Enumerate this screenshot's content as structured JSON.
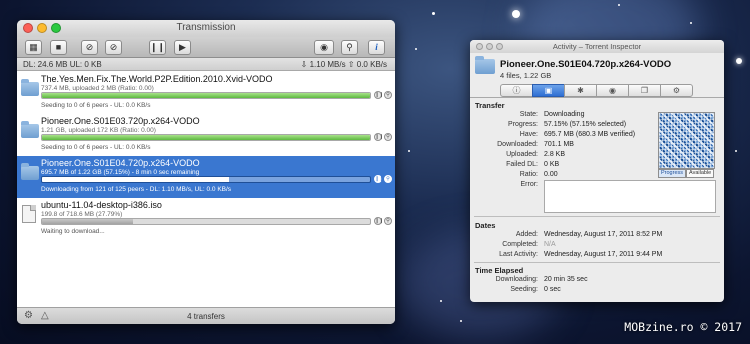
{
  "transmission": {
    "title": "Transmission",
    "toolbar": {
      "icons": [
        "create-torrent-icon",
        "open-folder-icon",
        "remove-icon",
        "stop-icon",
        "pause-all-icon",
        "resume-all-icon",
        "quicklook-eye-icon",
        "search-icon",
        "info-icon"
      ],
      "info_label": "i"
    },
    "status_bar": {
      "left": "DL: 24.6 MB  UL: 0 KB",
      "right": "⇩ 1.10 MB/s  ⇧ 0.0 KB/s"
    },
    "torrents": [
      {
        "name": "The.Yes.Men.Fix.The.World.P2P.Edition.2010.Xvid-VODO",
        "info": "737.4 MB, uploaded 2 MB (Ratio: 0.00)",
        "status": "Seeding to 0 of 6 peers - UL: 0.0 KB/s",
        "progress": 1.0,
        "state": "seeding",
        "icon": "folder-icon"
      },
      {
        "name": "Pioneer.One.S01E03.720p.x264-VODO",
        "info": "1.21 GB, uploaded 172 KB (Ratio: 0.00)",
        "status": "Seeding to 0 of 6 peers - UL: 0.0 KB/s",
        "progress": 1.0,
        "state": "seeding",
        "icon": "folder-icon"
      },
      {
        "name": "Pioneer.One.S01E04.720p.x264-VODO",
        "info": "695.7 MB of 1.22 GB (57.15%) - 8 min 0 sec remaining",
        "status": "Downloading from 121 of 125 peers - DL: 1.10 MB/s, UL: 0.0 KB/s",
        "progress": 0.5715,
        "state": "downloading",
        "selected": true,
        "icon": "folder-icon"
      },
      {
        "name": "ubuntu-11.04-desktop-i386.iso",
        "info": "199.8 of 718.6 MB (27.79%)",
        "status": "Waiting to download...",
        "progress": 0.2779,
        "state": "waiting",
        "icon": "file-icon"
      }
    ],
    "footer": {
      "count": "4 transfers",
      "gear_icon": "gear-icon",
      "turtle_icon": "turtle-icon"
    }
  },
  "inspector": {
    "title": "Activity – Torrent Inspector",
    "name": "Pioneer.One.S01E04.720p.x264-VODO",
    "subtitle": "4 files, 1.22 GB",
    "tabs": [
      "info-icon",
      "activity-icon",
      "trackers-icon",
      "peers-icon",
      "files-icon",
      "options-icon"
    ],
    "active_tab": 1,
    "transfer": {
      "heading": "Transfer",
      "state_label": "State:",
      "state": "Downloading",
      "progress_label": "Progress:",
      "progress": "57.15% (57.15% selected)",
      "have_label": "Have:",
      "have": "695.7 MB (680.3 MB verified)",
      "downloaded_label": "Downloaded:",
      "downloaded": "701.1 MB",
      "uploaded_label": "Uploaded:",
      "uploaded": "2.8 KB",
      "failed_label": "Failed DL:",
      "failed": "0 KB",
      "ratio_label": "Ratio:",
      "ratio": "0.00",
      "error_label": "Error:"
    },
    "pieces_buttons": {
      "progress": "Progress",
      "available": "Available"
    },
    "dates": {
      "heading": "Dates",
      "added_label": "Added:",
      "added": "Wednesday, August 17, 2011 8:52 PM",
      "completed_label": "Completed:",
      "completed": "N/A",
      "last_label": "Last Activity:",
      "last": "Wednesday, August 17, 2011 9:44 PM"
    },
    "time": {
      "heading": "Time Elapsed",
      "downloading_label": "Downloading:",
      "downloading": "20 min 35 sec",
      "seeding_label": "Seeding:",
      "seeding": "0 sec"
    }
  },
  "watermark": "MOBzine.ro © 2017",
  "colors": {
    "selection": "#3a77d0",
    "progress_green": "#5db940",
    "tab_active": "#2f6fd3"
  }
}
